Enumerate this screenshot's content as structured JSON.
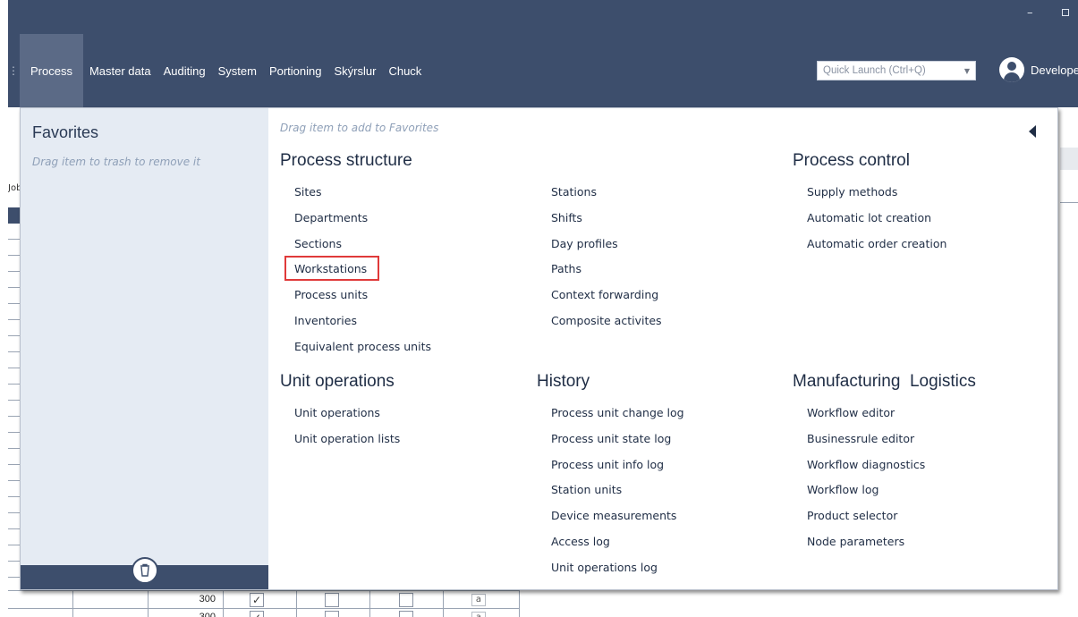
{
  "window": {
    "minimize_glyph": "–"
  },
  "menu": {
    "separator_glyph": "⋮",
    "items": [
      {
        "label": "Process",
        "active": true
      },
      {
        "label": "Master data"
      },
      {
        "label": "Auditing"
      },
      {
        "label": "System"
      },
      {
        "label": "Portioning"
      },
      {
        "label": "Skýrslur"
      },
      {
        "label": "Chuck"
      }
    ]
  },
  "quick_launch": {
    "placeholder": "Quick Launch (Ctrl+Q)",
    "arrow_glyph": "▼"
  },
  "user": {
    "name": "Develope",
    "icon": "user-avatar-icon"
  },
  "background_grid": {
    "header_partial": "Job",
    "rows": [
      {
        "value": "300",
        "checked": true,
        "a_glyph": "a"
      },
      {
        "value": "300",
        "checked": true,
        "a_glyph": "a"
      }
    ]
  },
  "favorites": {
    "title": "Favorites",
    "hint": "Drag item to trash to remove it",
    "trash_icon": "trash-icon"
  },
  "panel": {
    "hint": "Drag item to add to Favorites",
    "collapse_icon": "collapse-left-arrow-icon",
    "highlight_color": "#e03a3a",
    "accent_color": "#3d4e6c"
  },
  "sections": {
    "process_structure": {
      "title": "Process structure",
      "col1": [
        "Sites",
        "Departments",
        "Sections",
        "Workstations",
        "Process units",
        "Inventories",
        "Equivalent process units"
      ],
      "col2": [
        "Stations",
        "Shifts",
        "Day profiles",
        "Paths",
        "Context forwarding",
        "Composite activites"
      ]
    },
    "process_control": {
      "title": "Process control",
      "items": [
        "Supply methods",
        "Automatic lot creation",
        "Automatic order creation"
      ]
    },
    "unit_operations": {
      "title": "Unit operations",
      "items": [
        "Unit operations",
        "Unit operation lists"
      ]
    },
    "history": {
      "title": "History",
      "items": [
        "Process unit change log",
        "Process unit state log",
        "Process unit info log",
        "Station units",
        "Device measurements",
        "Access log",
        "Unit operations log"
      ]
    },
    "manufacturing_logistics": {
      "title": "Manufacturing  Logistics",
      "items": [
        "Workflow editor",
        "Businessrule editor",
        "Workflow diagnostics",
        "Workflow log",
        "Product selector",
        "Node parameters"
      ]
    }
  }
}
